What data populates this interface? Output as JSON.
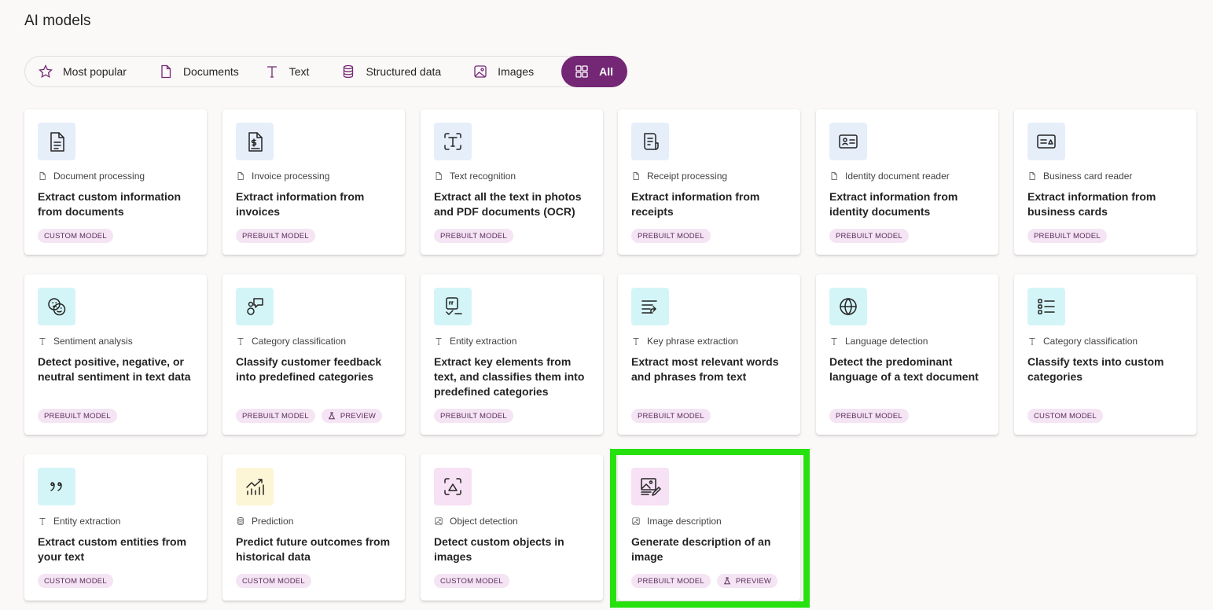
{
  "page": {
    "title": "AI models"
  },
  "filters": [
    {
      "id": "most-popular",
      "label": "Most popular",
      "icon": "star-icon",
      "active": false
    },
    {
      "id": "documents",
      "label": "Documents",
      "icon": "document-icon",
      "active": false
    },
    {
      "id": "text",
      "label": "Text",
      "icon": "text-icon",
      "active": false
    },
    {
      "id": "structured-data",
      "label": "Structured data",
      "icon": "database-icon",
      "active": false
    },
    {
      "id": "images",
      "label": "Images",
      "icon": "image-icon",
      "active": false
    },
    {
      "id": "all",
      "label": "All",
      "icon": "grid-icon",
      "active": true
    }
  ],
  "colors": {
    "accent": "#742774",
    "badge_bg": "#f4e4f4",
    "highlight": "#27e10f"
  },
  "cards": [
    {
      "category": "Document processing",
      "title": "Extract custom information from documents",
      "badges": [
        "CUSTOM MODEL"
      ],
      "icon": "document-lines-icon",
      "category_icon": "document-icon"
    },
    {
      "category": "Invoice processing",
      "title": "Extract information from invoices",
      "badges": [
        "PREBUILT MODEL"
      ],
      "icon": "invoice-dollar-icon",
      "category_icon": "document-icon"
    },
    {
      "category": "Text recognition",
      "title": "Extract all the text in photos and PDF documents (OCR)",
      "badges": [
        "PREBUILT MODEL"
      ],
      "icon": "text-scan-icon",
      "category_icon": "document-icon"
    },
    {
      "category": "Receipt processing",
      "title": "Extract information from receipts",
      "badges": [
        "PREBUILT MODEL"
      ],
      "icon": "receipt-icon",
      "category_icon": "document-icon"
    },
    {
      "category": "Identity document reader",
      "title": "Extract information from identity documents",
      "badges": [
        "PREBUILT MODEL"
      ],
      "icon": "id-card-icon",
      "category_icon": "document-icon"
    },
    {
      "category": "Business card reader",
      "title": "Extract information from business cards",
      "badges": [
        "PREBUILT MODEL"
      ],
      "icon": "business-card-icon",
      "category_icon": "document-icon"
    },
    {
      "category": "Sentiment analysis",
      "title": "Detect positive, negative, or neutral sentiment in text data",
      "badges": [
        "PREBUILT MODEL"
      ],
      "icon": "emoji-faces-icon",
      "category_icon": "text-icon"
    },
    {
      "category": "Category classification",
      "title": "Classify customer feedback into predefined categories",
      "badges": [
        "PREBUILT MODEL",
        "PREVIEW"
      ],
      "icon": "feedback-icon",
      "category_icon": "text-icon"
    },
    {
      "category": "Entity extraction",
      "title": "Extract key elements from text, and classifies them into predefined categories",
      "badges": [
        "PREBUILT MODEL"
      ],
      "icon": "quote-check-icon",
      "category_icon": "text-icon"
    },
    {
      "category": "Key phrase extraction",
      "title": "Extract most relevant words and phrases from text",
      "badges": [
        "PREBUILT MODEL"
      ],
      "icon": "text-arrow-icon",
      "category_icon": "text-icon"
    },
    {
      "category": "Language detection",
      "title": "Detect the predominant language of a text document",
      "badges": [
        "PREBUILT MODEL"
      ],
      "icon": "globe-icon",
      "category_icon": "text-icon"
    },
    {
      "category": "Category classification",
      "title": "Classify texts into custom categories",
      "badges": [
        "CUSTOM MODEL"
      ],
      "icon": "list-icon",
      "category_icon": "text-icon"
    },
    {
      "category": "Entity extraction",
      "title": "Extract custom entities from your text",
      "badges": [
        "CUSTOM MODEL"
      ],
      "icon": "quote-icon",
      "category_icon": "text-icon"
    },
    {
      "category": "Prediction",
      "title": "Predict future outcomes from historical data",
      "badges": [
        "CUSTOM MODEL"
      ],
      "icon": "trend-chart-icon",
      "category_icon": "database-icon"
    },
    {
      "category": "Object detection",
      "title": "Detect custom objects in images",
      "badges": [
        "CUSTOM MODEL"
      ],
      "icon": "scan-object-icon",
      "category_icon": "image-icon"
    },
    {
      "category": "Image description",
      "title": "Generate description of an image",
      "badges": [
        "PREBUILT MODEL",
        "PREVIEW"
      ],
      "icon": "image-edit-icon",
      "category_icon": "image-icon"
    }
  ]
}
